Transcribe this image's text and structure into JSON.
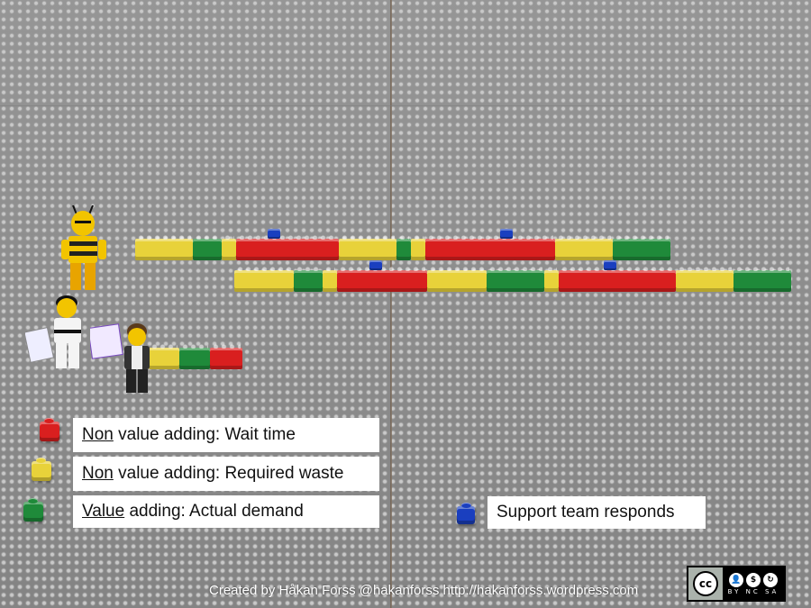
{
  "colors": {
    "wait": "#d91f1f",
    "required_waste": "#e8d23a",
    "value": "#1f8a3a",
    "support": "#1a3fbf"
  },
  "legend": {
    "wait_underlined": "Non",
    "wait_rest": " value adding: Wait time",
    "waste_underlined": "Non",
    "waste_rest": " value adding: Required waste",
    "value_underlined": "Value",
    "value_rest": " adding: Actual demand",
    "support": "Support team responds"
  },
  "credit": "Created by Håkan Forss @hakanforss http://hakanforss.wordpress.com",
  "license": {
    "logo": "cc",
    "terms": "BY NC SA",
    "icons": [
      "by-icon",
      "nc-icon",
      "sa-icon"
    ]
  }
}
